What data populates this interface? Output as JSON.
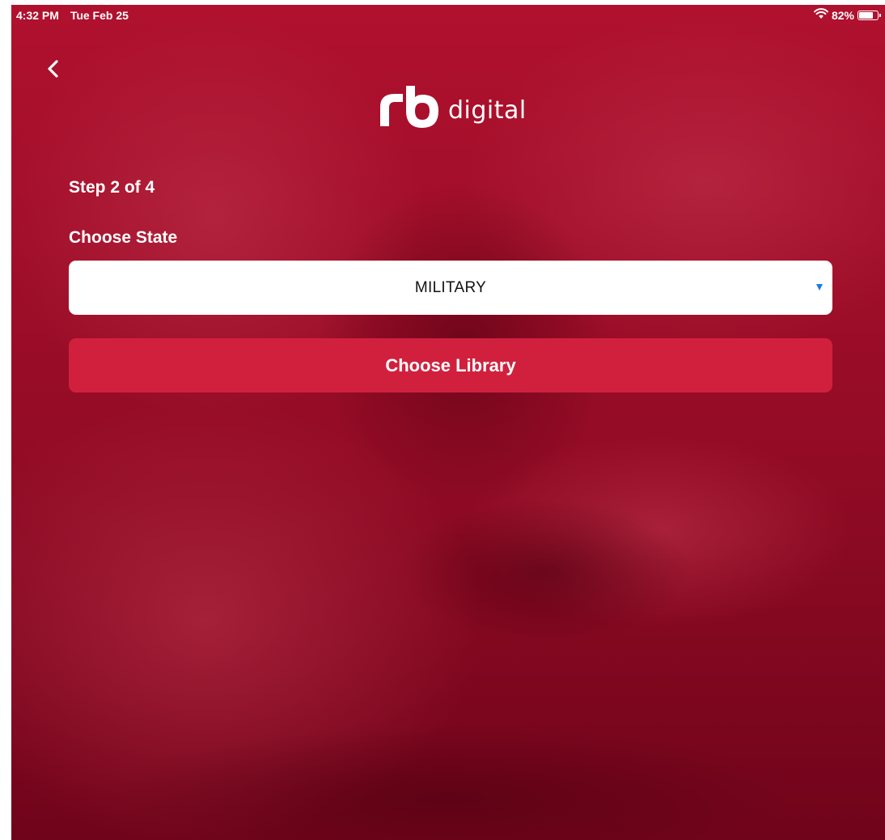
{
  "status_bar": {
    "time": "4:32 PM",
    "date": "Tue Feb 25",
    "battery_text": "82%",
    "battery_level": 0.82
  },
  "header": {
    "logo_mark": "rb",
    "logo_word": "digital"
  },
  "content": {
    "step_text": "Step 2 of 4",
    "state_label": "Choose State",
    "state_value": "MILITARY",
    "button_label": "Choose Library"
  },
  "icons": {
    "back": "chevron-left-icon",
    "wifi": "wifi-icon",
    "battery": "battery-icon",
    "dropdown": "dropdown-arrow-icon"
  },
  "colors": {
    "background": "#8e0a22",
    "button": "#d1203e",
    "dropdown_arrow": "#1a7be0",
    "text": "#ffffff"
  }
}
